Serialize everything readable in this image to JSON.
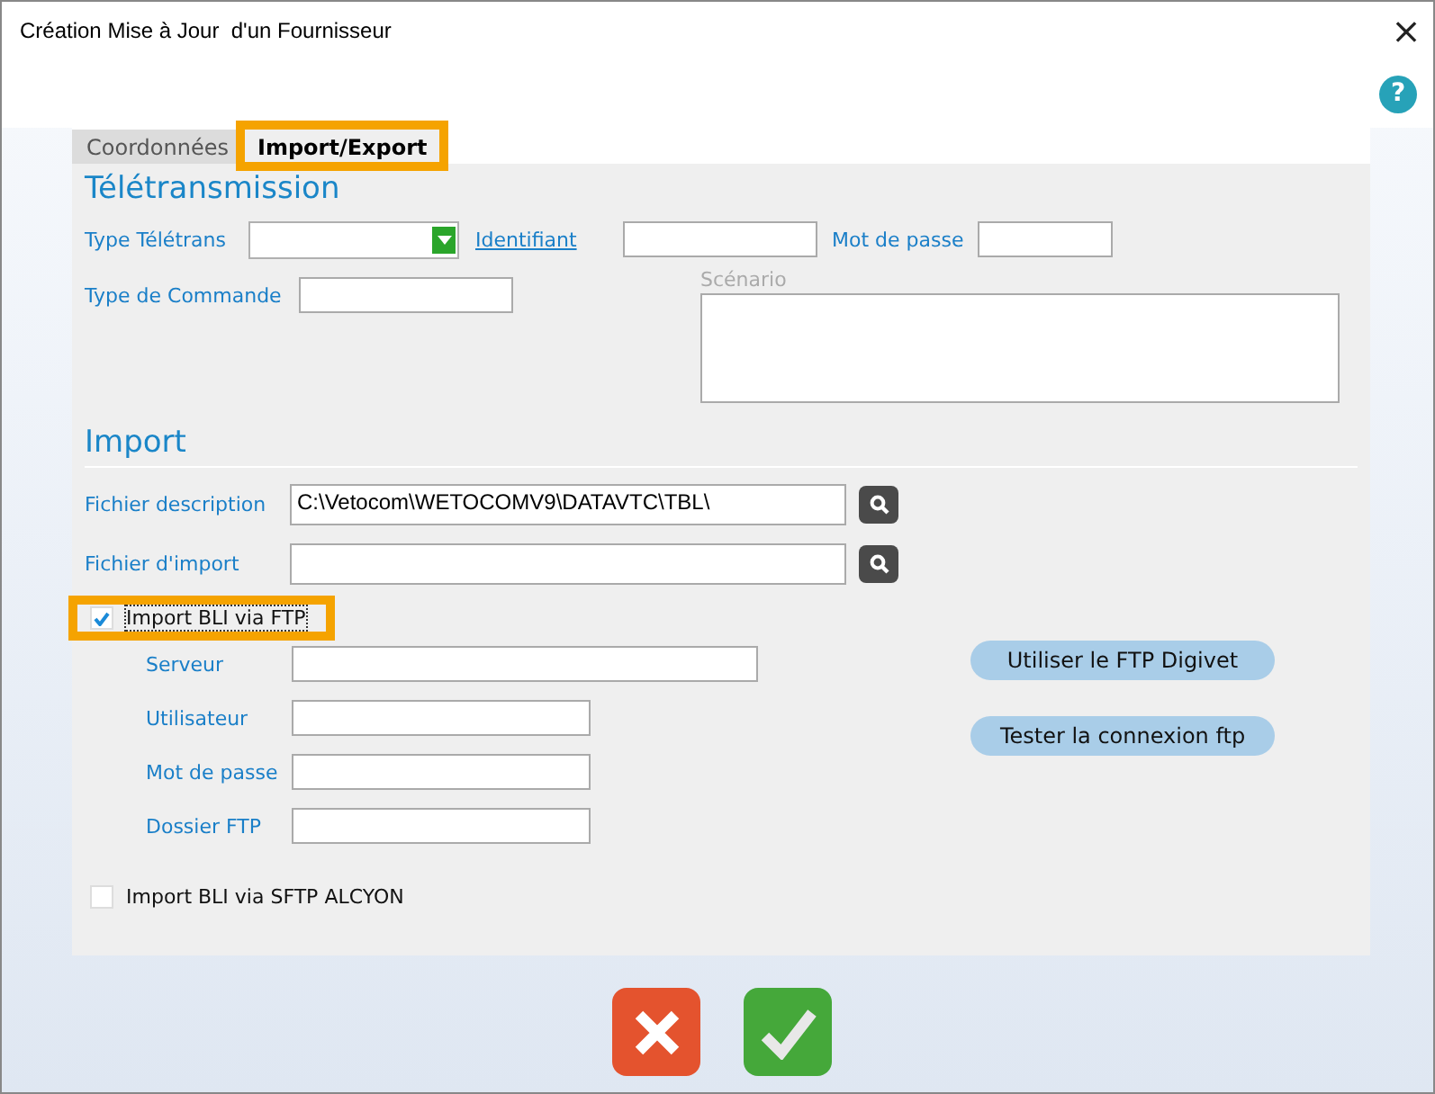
{
  "window": {
    "title": "Création Mise à Jour  d'un Fournisseur",
    "close": "×",
    "help": "?"
  },
  "tabs": [
    {
      "label": "Coordonnées",
      "selected": false,
      "highlighted": false
    },
    {
      "label": "Import/Export",
      "selected": true,
      "highlighted": true
    }
  ],
  "teletransmission": {
    "heading": "Télétransmission",
    "type_label": "Type Télétrans",
    "identifiant_label": "Identifiant",
    "mot_de_passe_label": "Mot de passe",
    "commande_label": "Type de Commande",
    "scenario_label": "Scénario"
  },
  "import": {
    "heading": "Import",
    "fichier_description_label": "Fichier description",
    "fichier_description_value": "C:\\Vetocom\\WETOCOMV9\\DATAVTC\\TBL\\",
    "fichier_import_label": "Fichier d'import",
    "ftp_checkbox": {
      "label": "Import BLI via FTP",
      "checked": true,
      "highlighted": true
    },
    "ftp_fields": [
      {
        "label": "Serveur",
        "wide": true
      },
      {
        "label": "Utilisateur",
        "wide": false
      },
      {
        "label": "Mot de passe",
        "wide": false
      },
      {
        "label": "Dossier FTP",
        "wide": false
      }
    ],
    "ftp_buttons": [
      "Utiliser le FTP Digivet",
      "Tester la connexion ftp"
    ],
    "sftp_checkbox": {
      "label": "Import BLI via SFTP ALCYON",
      "checked": false
    }
  },
  "actions": [
    {
      "kind": "cancel"
    },
    {
      "kind": "ok"
    }
  ]
}
